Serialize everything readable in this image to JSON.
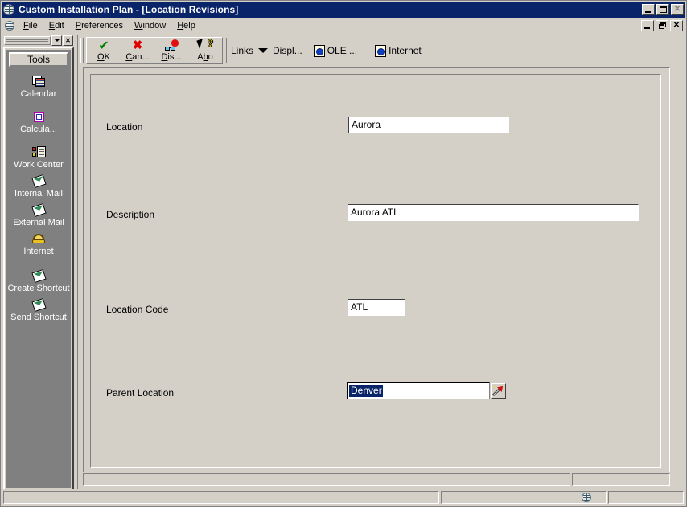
{
  "window": {
    "title": "Custom Installation Plan - [Location Revisions]",
    "app_icon": "globe-icon",
    "buttons": {
      "minimize": "_",
      "maximize": "□",
      "close": "✕"
    }
  },
  "menubar": {
    "icon": "globe-icon",
    "items": [
      {
        "label": "File",
        "accel": "F"
      },
      {
        "label": "Edit",
        "accel": "E"
      },
      {
        "label": "Preferences",
        "accel": "P"
      },
      {
        "label": "Window",
        "accel": "W"
      },
      {
        "label": "Help",
        "accel": "H"
      }
    ],
    "mdi_buttons": {
      "minimize": "_",
      "restore": "❐",
      "close": "✕"
    }
  },
  "sidebar": {
    "title": "Tools",
    "close_button": "✕",
    "dropdown_button": "chevron-down-icon",
    "items": [
      {
        "label": "Calendar",
        "icon": "calendar-icon"
      },
      {
        "label": "Calcula...",
        "icon": "calculator-icon"
      },
      {
        "label": "Work Center",
        "icon": "work-center-icon"
      },
      {
        "label": "Internal Mail",
        "icon": "envelope-icon"
      },
      {
        "label": "External Mail",
        "icon": "envelope-icon"
      },
      {
        "label": "Internet",
        "icon": "phone-icon"
      },
      {
        "label": "Create Shortcut",
        "icon": "envelope-icon"
      },
      {
        "label": "Send Shortcut",
        "icon": "envelope-icon"
      }
    ]
  },
  "toolbar": {
    "buttons": [
      {
        "label": "OK",
        "accel": "O",
        "icon": "green-check-icon"
      },
      {
        "label": "Can...",
        "accel": "C",
        "icon": "red-x-icon"
      },
      {
        "label": "Dis...",
        "accel": "D",
        "icon": "glasses-balloon-icon"
      },
      {
        "label": "Abo",
        "accel": "b",
        "icon": "cursor-question-icon"
      }
    ],
    "links_label": "Links",
    "links_dropdown_icon": "triangle-down-icon",
    "display_label": "Displ...",
    "ole_label": "OLE ...",
    "ole_icon": "document-globe-icon",
    "internet_label": "Internet",
    "internet_icon": "document-globe-icon"
  },
  "form": {
    "fields": [
      {
        "name": "location",
        "label": "Location",
        "value": "Aurora",
        "selected": false,
        "has_visual_assist": false
      },
      {
        "name": "description",
        "label": "Description",
        "value": "Aurora ATL",
        "selected": false,
        "has_visual_assist": false
      },
      {
        "name": "location_code",
        "label": "Location Code",
        "value": "ATL",
        "selected": false,
        "has_visual_assist": false
      },
      {
        "name": "parent_location",
        "label": "Parent Location",
        "value": "Denver",
        "selected": true,
        "has_visual_assist": true,
        "visual_assist_icon": "magic-wand-icon"
      }
    ]
  },
  "statusbar": {
    "panes": [
      "",
      "",
      ""
    ],
    "globe_icon": "globe-icon"
  }
}
